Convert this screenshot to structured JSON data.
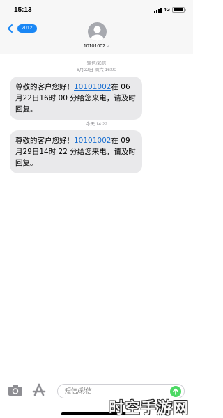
{
  "status_bar": {
    "time": "15:13",
    "network": "4G"
  },
  "header": {
    "back_label": "2012",
    "contact_name": "10101002",
    "contact_chevron": ">"
  },
  "messages": [
    {
      "meta_type": "短信/彩信",
      "meta_time": "6月22日 周六 16:00",
      "text_before": "尊敬的客户您好！",
      "link": "10101002",
      "text_after": "在 06 月22日16时 00 分给您来电，请及时回复。"
    },
    {
      "meta_time": "今天 14:22",
      "text_before": "尊敬的客户您好！",
      "link": "10101002",
      "text_after": "在 09 月29日14时 22 分给您来电，请及时回复。"
    }
  ],
  "input": {
    "placeholder": "短信/彩信"
  },
  "watermark": "时空手游网",
  "colors": {
    "accent": "#1a87f5",
    "bubble": "#e9e9eb",
    "send": "#4cd964"
  },
  "icons": [
    "back-chevron-icon",
    "contact-avatar-icon",
    "camera-icon",
    "appstore-icon",
    "send-arrow-icon"
  ]
}
